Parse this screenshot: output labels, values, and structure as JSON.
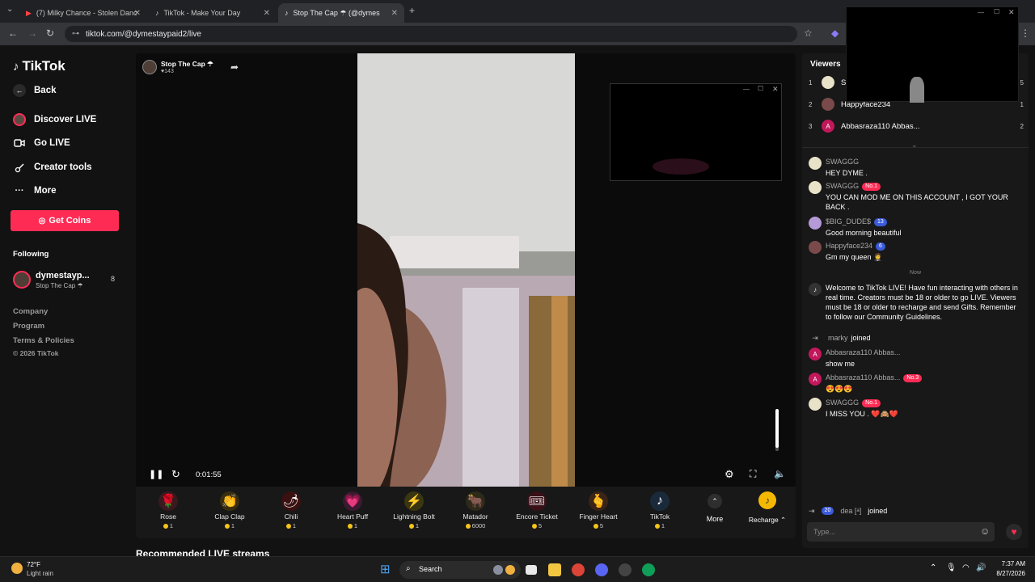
{
  "browser": {
    "tabs": [
      {
        "label": "(7) Milky Chance - Stolen Danc",
        "active": false
      },
      {
        "label": "TikTok - Make Your Day",
        "active": false
      },
      {
        "label": "Stop The Cap ☂ (@dymes",
        "active": true
      }
    ],
    "new_tab": "+",
    "url": "tiktok.com/@dymestaypaid2/live"
  },
  "sidebar": {
    "logo": "TikTok",
    "back": "Back",
    "items": [
      {
        "label": "Discover LIVE",
        "icon": "avatar-icon"
      },
      {
        "label": "Go LIVE",
        "icon": "video-camera-icon"
      },
      {
        "label": "Creator tools",
        "icon": "creator-tools-icon"
      },
      {
        "label": "More",
        "icon": "more-dots-icon"
      }
    ],
    "get_coins": "Get Coins",
    "following_title": "Following",
    "following": [
      {
        "name": "dymestayp...",
        "sub": "Stop The Cap ☂",
        "count": "8"
      }
    ],
    "footer": [
      "Company",
      "Program",
      "Terms & Policies",
      "© 2026 TikTok"
    ]
  },
  "stream": {
    "host_name": "Stop The Cap ☂",
    "likes": "♥143",
    "time": "0:01:55",
    "recommended": "Recommended LIVE streams"
  },
  "gifts": [
    {
      "name": "Rose",
      "price": "1",
      "icon": "🌹"
    },
    {
      "name": "Clap Clap",
      "price": "1",
      "icon": "👏"
    },
    {
      "name": "Chili",
      "price": "1",
      "icon": "🌶"
    },
    {
      "name": "Heart Puff",
      "price": "1",
      "icon": "💗"
    },
    {
      "name": "Lightning Bolt",
      "price": "1",
      "icon": "⚡"
    },
    {
      "name": "Matador",
      "price": "6000",
      "icon": "🐂"
    },
    {
      "name": "Encore Ticket",
      "price": "5",
      "icon": "🎟"
    },
    {
      "name": "Finger Heart",
      "price": "5",
      "icon": "🫰"
    },
    {
      "name": "TikTok",
      "price": "1",
      "icon": "♪"
    }
  ],
  "gift_more": "More",
  "recharge": "Recharge",
  "viewers": {
    "title": "Viewers",
    "list": [
      {
        "rank": "1",
        "name": "SW",
        "count": "5",
        "avatar_color": "#e8e2c8",
        "letter": ""
      },
      {
        "rank": "2",
        "name": "Happyface234",
        "count": "1",
        "avatar_color": "#7a4a4a",
        "letter": ""
      },
      {
        "rank": "3",
        "name": "Abbasraza110 Abbas...",
        "count": "2",
        "avatar_color": "#c2185b",
        "letter": "A"
      }
    ]
  },
  "chat": [
    {
      "user": "SWAGGG",
      "badge": "",
      "text": "HEY DYME .",
      "avatar_color": "#e8e2c8",
      "letter": ""
    },
    {
      "user": "SWAGGG",
      "badge": "No.1",
      "badge_color": "#fe2c55",
      "text": "YOU CAN MOD ME ON THIS ACCOUNT , I GOT YOUR BACK .",
      "avatar_color": "#e8e2c8",
      "letter": ""
    },
    {
      "user": "$BIG_DUDE$",
      "badge": "13",
      "badge_color": "#3b5bdb",
      "text": "Good morning beautiful",
      "avatar_color": "#b49ad6",
      "letter": ""
    },
    {
      "user": "Happyface234",
      "badge": "6",
      "badge_color": "#3b5bdb",
      "text": "Gm my queen 🤵",
      "avatar_color": "#7a4a4a",
      "letter": ""
    }
  ],
  "chat_divider": "Now",
  "system_msg": "Welcome to TikTok LIVE! Have fun interacting with others in real time. Creators must be 18 or older to go LIVE. Viewers must be 18 or older to recharge and send Gifts. Remember to follow our Community Guidelines.",
  "chat2": [
    {
      "kind": "join",
      "user": "marky",
      "text": "joined"
    },
    {
      "kind": "msg",
      "user": "Abbasraza110 Abbas...",
      "badge": "",
      "text": "show me",
      "avatar_color": "#c2185b",
      "letter": "A"
    },
    {
      "kind": "msg",
      "user": "Abbasraza110 Abbas...",
      "badge": "No.3",
      "badge_color": "#fe2c55",
      "text": "😍😍😍",
      "avatar_color": "#c2185b",
      "letter": "A"
    },
    {
      "kind": "msg",
      "user": "SWAGGG",
      "badge": "No.1",
      "badge_color": "#fe2c55",
      "text": "I MISS YOU . ❤️🙈❤️",
      "avatar_color": "#e8e2c8",
      "letter": ""
    }
  ],
  "last_join": {
    "badge": "20",
    "user": "dea [ᵃ]",
    "text": "joined"
  },
  "chat_input_placeholder": "Type...",
  "taskbar": {
    "weather_temp": "72°F",
    "weather_desc": "Light rain",
    "search": "Search",
    "time": "7:37 AM",
    "date": "8/27/2026"
  },
  "colors": {
    "accent": "#fe2c55",
    "bg": "#121212",
    "panel": "#181818"
  }
}
